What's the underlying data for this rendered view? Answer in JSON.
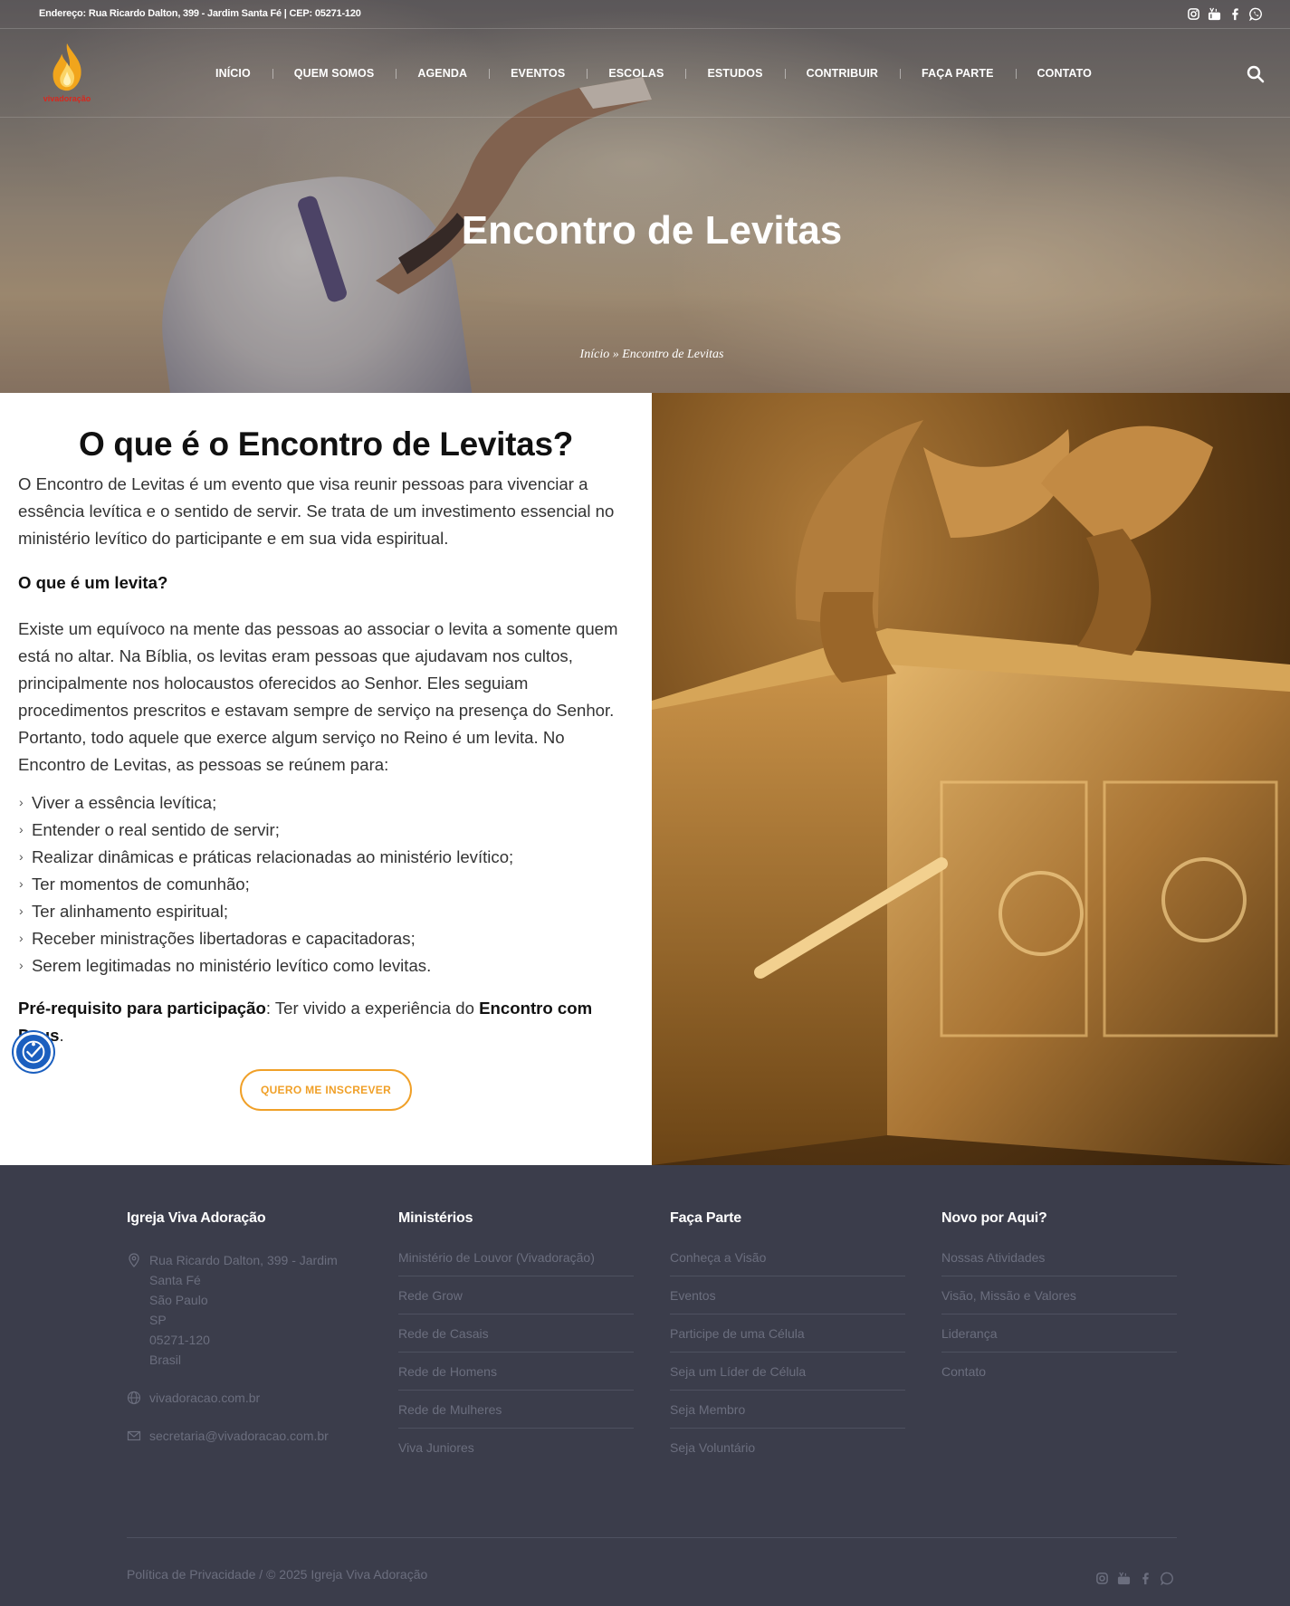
{
  "topbar": {
    "address": "Endereço: Rua Ricardo Dalton, 399 - Jardim Santa Fé | CEP: 05271-120",
    "social": [
      "instagram-icon",
      "youtube-icon",
      "facebook-icon",
      "whatsapp-icon"
    ]
  },
  "logo": {
    "text": "vivadoração"
  },
  "nav": [
    "INÍCIO",
    "QUEM SOMOS",
    "AGENDA",
    "EVENTOS",
    "ESCOLAS",
    "ESTUDOS",
    "CONTRIBUIR",
    "FAÇA PARTE",
    "CONTATO"
  ],
  "hero": {
    "title": "Encontro de Levitas",
    "breadcrumb": "Início » Encontro de Levitas"
  },
  "content": {
    "heading": "O que é o Encontro de Levitas?",
    "intro": "O Encontro de Levitas é um evento que visa reunir pessoas para vivenciar a essência levítica e o sentido de servir. Se trata de um investimento essencial no ministério levítico do participante e em sua vida espiritual.",
    "subheading": "O que é um levita?",
    "body": "Existe um equívoco na mente das pessoas ao associar o levita a somente quem está no altar. Na Bíblia, os levitas eram pessoas que ajudavam nos cultos, principalmente nos holocaustos oferecidos ao Senhor. Eles seguiam procedimentos prescritos e estavam sempre de serviço na presença do Senhor. Portanto, todo aquele que exerce algum serviço no Reino é um levita. No Encontro de Levitas, as pessoas se reúnem para:",
    "bullets": [
      "Viver a essência levítica;",
      "Entender o real sentido de servir;",
      "Realizar dinâmicas e práticas relacionadas ao ministério levítico;",
      "Ter momentos de comunhão;",
      "Ter alinhamento espiritual;",
      "Receber ministrações libertadoras e capacitadoras;",
      "Serem legitimadas no ministério levítico como levitas."
    ],
    "prereq_label": "Pré-requisito para participação",
    "prereq_text": ": Ter vivido a experiência do ",
    "prereq_bold": "Encontro com Deus",
    "prereq_end": ".",
    "button": "QUERO ME INSCREVER"
  },
  "footer": {
    "col1": {
      "title": "Igreja Viva Adoração",
      "address": [
        "Rua Ricardo Dalton, 399 - Jardim",
        "Santa Fé",
        "São Paulo",
        "SP",
        "05271-120",
        "Brasil"
      ],
      "website": "vivadoracao.com.br",
      "email": "secretaria@vivadoracao.com.br"
    },
    "col2": {
      "title": "Ministérios",
      "links": [
        "Ministério de Louvor (Vivadoração)",
        "Rede Grow",
        "Rede de Casais",
        "Rede de Homens",
        "Rede de Mulheres",
        "Viva Juniores"
      ]
    },
    "col3": {
      "title": "Faça Parte",
      "links": [
        "Conheça a Visão",
        "Eventos",
        "Participe de uma Célula",
        "Seja um Líder de Célula",
        "Seja Membro",
        "Seja Voluntário"
      ]
    },
    "col4": {
      "title": "Novo por Aqui?",
      "links": [
        "Nossas Atividades",
        "Visão, Missão e Valores",
        "Liderança",
        "Contato"
      ]
    },
    "copyright": "Política de Privacidade / © 2025 Igreja Viva Adoração"
  },
  "colors": {
    "accent": "#f0a028",
    "footer_bg": "#3b3d4b",
    "a11y": "#1b5fbf"
  }
}
